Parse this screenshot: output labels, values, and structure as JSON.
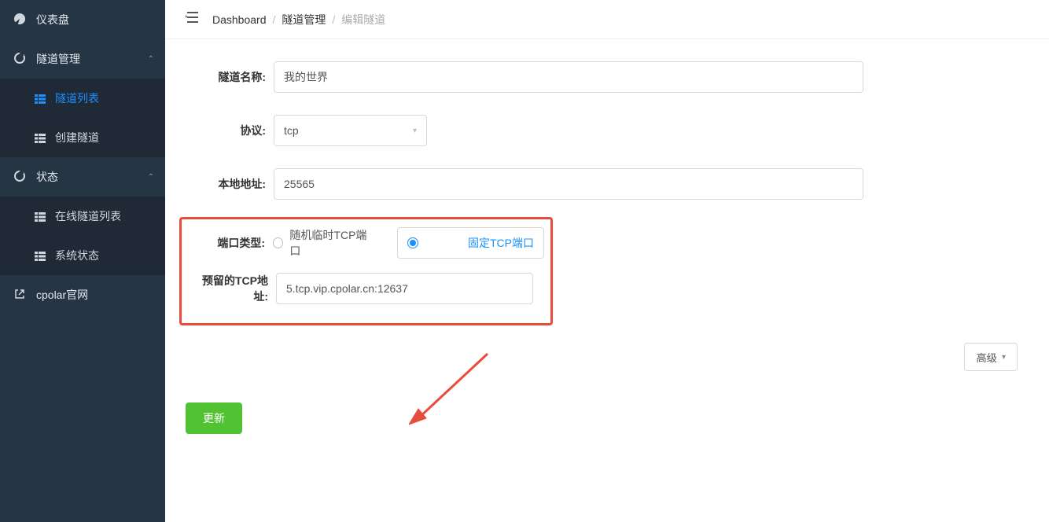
{
  "sidebar": {
    "items": [
      {
        "label": "仪表盘"
      },
      {
        "label": "隧道管理"
      },
      {
        "label": "状态"
      }
    ],
    "tunnel_sub": [
      {
        "label": "隧道列表"
      },
      {
        "label": "创建隧道"
      }
    ],
    "status_sub": [
      {
        "label": "在线隧道列表"
      },
      {
        "label": "系统状态"
      }
    ],
    "footer": {
      "label": "cpolar官网"
    }
  },
  "breadcrumb": {
    "items": [
      "Dashboard",
      "隧道管理",
      "编辑隧道"
    ]
  },
  "form": {
    "name_label": "隧道名称:",
    "name_value": "我的世界",
    "protocol_label": "协议:",
    "protocol_value": "tcp",
    "local_addr_label": "本地地址:",
    "local_addr_value": "25565",
    "port_type_label": "端口类型:",
    "port_type_options": {
      "random": "随机临时TCP端口",
      "fixed": "固定TCP端口"
    },
    "port_type_selected": "fixed",
    "reserved_tcp_label": "预留的TCP地址:",
    "reserved_tcp_value": "5.tcp.vip.cpolar.cn:12637",
    "advanced_label": "高级",
    "submit_label": "更新"
  },
  "colors": {
    "accent": "#1890ff",
    "annotation": "#e74c3c",
    "success": "#51c332",
    "sidebar_bg": "#263544"
  }
}
